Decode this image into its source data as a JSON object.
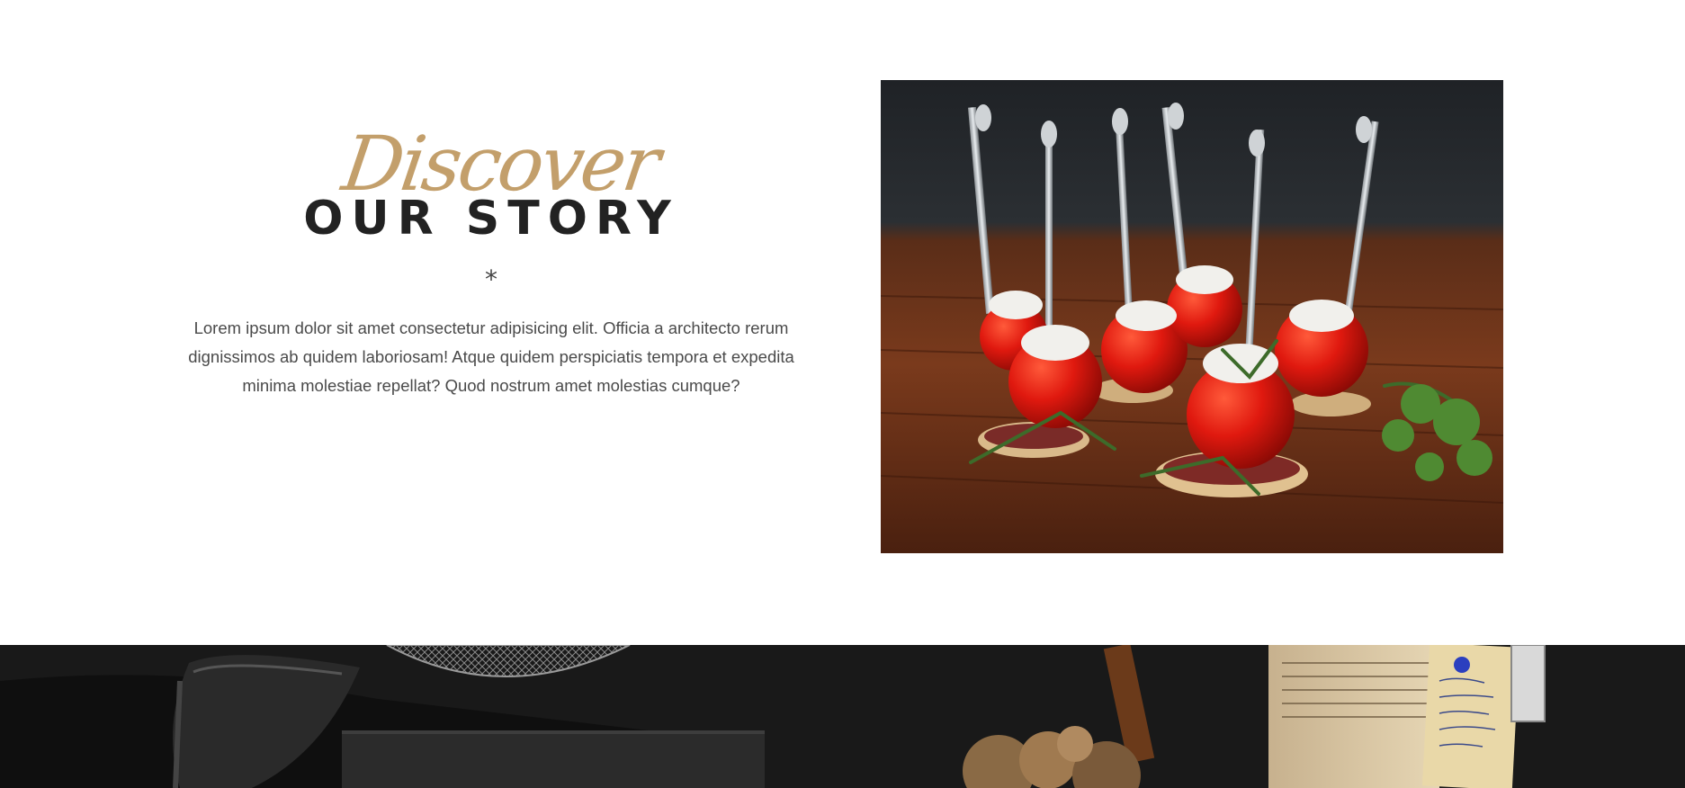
{
  "story": {
    "script_title": "Discover",
    "title": "OUR STORY",
    "divider": "*",
    "body": "Lorem ipsum dolor sit amet consectetur adipisicing elit. Officia a architecto rerum dignissimos ab quidem laboriosam! Atque quidem perspiciatis tempora et expedita minima molestiae repellat? Quod nostrum amet molestias cumque?"
  },
  "colors": {
    "accent_gold": "#c39f6b",
    "title_dark": "#222222",
    "body_text": "#4a4a4a",
    "banner_dark": "#141414"
  },
  "images": {
    "story_photo": "tomato-canape-photo",
    "banner": "dark-kitchen-banner"
  }
}
